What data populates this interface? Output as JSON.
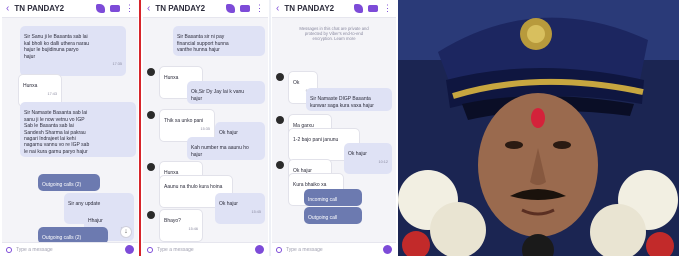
{
  "panels": [
    {
      "title": "TN PANDAY2",
      "placeholder": "Type a message",
      "messages": [
        {
          "dir": "out",
          "text": "Sir Sanu ji le Basanta sab lai\nkal bholi ko dalli uthera narau\nhajur le bujidinuna paryo\nhajur",
          "time": "17:35"
        },
        {
          "dir": "in",
          "text": "Hunxa",
          "time": "17:43"
        },
        {
          "dir": "out",
          "text": "Sir Namaste Basanta sab lai\nsanu ji le now vetnu vo IGP\nSab le Basanta sab lai\nSandesh Sharma lai pakrau\nnagari Indrajeet lai kehi\nnagarnu vannu vo re IGP sab\nle nai kura garnu paryo hajur",
          "time": ""
        },
        {
          "dir": "call",
          "text": "Outgoing calls (2)",
          "time": ""
        },
        {
          "dir": "out",
          "text": "Sir any update",
          "time": "15:17"
        },
        {
          "dir": "out",
          "text": "Hhajur",
          "time": "15:17"
        },
        {
          "dir": "call",
          "text": "Outgoing calls (2)",
          "time": ""
        }
      ]
    },
    {
      "title": "TN PANDAY2",
      "placeholder": "Type a message",
      "messages": [
        {
          "dir": "out",
          "text": "Sir Basanta sir ni pay\nfinancial support hunna\nvanthe hunna hajur",
          "time": ""
        },
        {
          "dir": "in",
          "text": "Hunxa",
          "time": "15:28"
        },
        {
          "dir": "out",
          "text": "Ok,Sir Dy Jay lai k vanu\nhajur",
          "time": ""
        },
        {
          "dir": "in",
          "text": "Thik xa unko pani",
          "time": "15:35"
        },
        {
          "dir": "out",
          "text": "Ok hajur",
          "time": "15:37"
        },
        {
          "dir": "out",
          "text": "Kah number ma aaunu ho\nhajur",
          "time": "15:38"
        },
        {
          "dir": "in",
          "text": "Hunxa",
          "time": "15:43"
        },
        {
          "dir": "in",
          "text": "Aaunu na thulo kura hoina",
          "time": "15:44"
        },
        {
          "dir": "out",
          "text": "Ok hajur",
          "time": "15:45"
        },
        {
          "dir": "in",
          "text": "Bhayo?",
          "time": "15:46"
        }
      ]
    },
    {
      "title": "TN PANDAY2",
      "placeholder": "Type a message",
      "notice": "Messages in this chat are private and\nprotected by Viber's end-to-end\nencryption. Learn more",
      "messages": [
        {
          "dir": "in",
          "text": "Ok",
          "time": "9:30"
        },
        {
          "dir": "out",
          "text": "Sir Namaste DIGP Basanta\nkunwar saga kura vaxa hajur",
          "time": ""
        },
        {
          "dir": "in",
          "text": "Ma garxu",
          "time": "10:12"
        },
        {
          "dir": "in",
          "text": "1-2 bajo pani janunu",
          "time": "10:12"
        },
        {
          "dir": "out",
          "text": "Ok hajur",
          "time": "10:12"
        },
        {
          "dir": "in",
          "text": "Ok hajur",
          "time": "10:47"
        },
        {
          "dir": "in",
          "text": "Kura bhaiko xa",
          "time": "10:48"
        },
        {
          "dir": "call",
          "text": "Incoming call",
          "time": ""
        },
        {
          "dir": "call",
          "text": "Outgoing call",
          "time": ""
        }
      ]
    }
  ],
  "photo": {
    "description_name": "police-officer-portrait"
  },
  "colors": {
    "accent": "#7d4bd8",
    "divider": "#d6242b",
    "bubble_out": "#dfe2f5",
    "call_bubble": "#6c7ab0"
  }
}
